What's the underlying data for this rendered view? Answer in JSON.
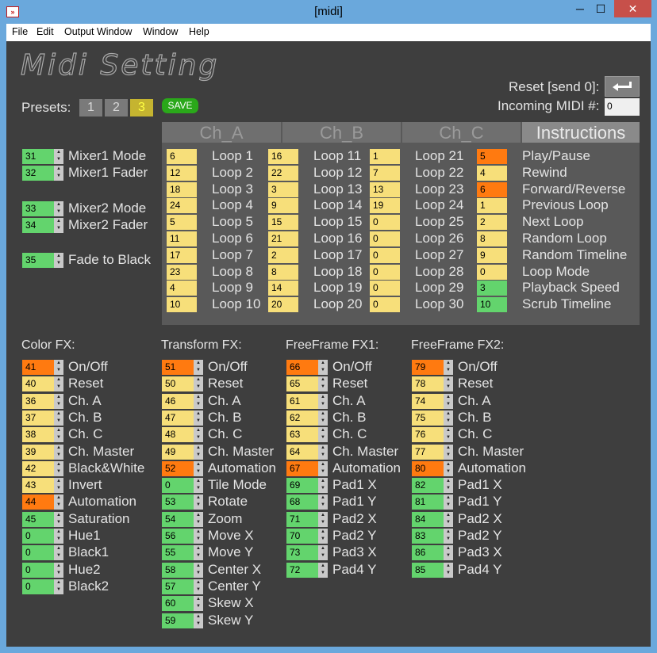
{
  "window": {
    "title": "[midi]",
    "icon": "app-icon",
    "controls": {
      "minimize": "─",
      "maximize": "☐",
      "close": "✕"
    }
  },
  "menu": [
    "File",
    "Edit",
    "Output Window",
    "Window",
    "Help"
  ],
  "heading": "Midi Setting",
  "reset_label": "Reset [send 0]:",
  "incoming_label": "Incoming MIDI #:",
  "incoming_value": "0",
  "presets": {
    "label": "Presets:",
    "items": [
      "1",
      "2",
      "3"
    ],
    "active": "3"
  },
  "save_label": "SAVE",
  "colors": {
    "yellow": "#f7df7a",
    "green": "#63d46d",
    "orange": "#ff7a10"
  },
  "mixers": [
    {
      "value": "31",
      "label": "Mixer1 Mode",
      "color": "green"
    },
    {
      "value": "32",
      "label": "Mixer1 Fader",
      "color": "green"
    },
    {
      "value": "33",
      "label": "Mixer2 Mode",
      "color": "green"
    },
    {
      "value": "34",
      "label": "Mixer2 Fader",
      "color": "green"
    },
    {
      "value": "35",
      "label": "Fade to Black",
      "color": "green"
    }
  ],
  "tabs": [
    "Ch_A",
    "Ch_B",
    "Ch_C",
    "Instructions"
  ],
  "ch_a": [
    {
      "value": "6",
      "label": "Loop 1"
    },
    {
      "value": "12",
      "label": "Loop 2"
    },
    {
      "value": "18",
      "label": "Loop 3"
    },
    {
      "value": "24",
      "label": "Loop 4"
    },
    {
      "value": "5",
      "label": "Loop 5"
    },
    {
      "value": "11",
      "label": "Loop 6"
    },
    {
      "value": "17",
      "label": "Loop 7"
    },
    {
      "value": "23",
      "label": "Loop 8"
    },
    {
      "value": "4",
      "label": "Loop 9"
    },
    {
      "value": "10",
      "label": "Loop 10"
    }
  ],
  "ch_b": [
    {
      "value": "16",
      "label": "Loop 11"
    },
    {
      "value": "22",
      "label": "Loop 12"
    },
    {
      "value": "3",
      "label": "Loop 13"
    },
    {
      "value": "9",
      "label": "Loop 14"
    },
    {
      "value": "15",
      "label": "Loop 15"
    },
    {
      "value": "21",
      "label": "Loop 16"
    },
    {
      "value": "2",
      "label": "Loop 17"
    },
    {
      "value": "8",
      "label": "Loop 18"
    },
    {
      "value": "14",
      "label": "Loop 19"
    },
    {
      "value": "20",
      "label": "Loop 20"
    }
  ],
  "ch_c": [
    {
      "value": "1",
      "label": "Loop 21"
    },
    {
      "value": "7",
      "label": "Loop 22"
    },
    {
      "value": "13",
      "label": "Loop 23"
    },
    {
      "value": "19",
      "label": "Loop 24"
    },
    {
      "value": "0",
      "label": "Loop 25"
    },
    {
      "value": "0",
      "label": "Loop 26"
    },
    {
      "value": "0",
      "label": "Loop 27"
    },
    {
      "value": "0",
      "label": "Loop 28"
    },
    {
      "value": "0",
      "label": "Loop 29"
    },
    {
      "value": "0",
      "label": "Loop 30"
    }
  ],
  "instructions": [
    {
      "value": "5",
      "label": "Play/Pause",
      "color": "orange"
    },
    {
      "value": "4",
      "label": "Rewind",
      "color": "yellow"
    },
    {
      "value": "6",
      "label": "Forward/Reverse",
      "color": "orange"
    },
    {
      "value": "1",
      "label": "Previous Loop",
      "color": "yellow"
    },
    {
      "value": "2",
      "label": "Next Loop",
      "color": "yellow"
    },
    {
      "value": "8",
      "label": "Random Loop",
      "color": "yellow"
    },
    {
      "value": "9",
      "label": "Random Timeline",
      "color": "yellow"
    },
    {
      "value": "0",
      "label": "Loop Mode",
      "color": "yellow"
    },
    {
      "value": "3",
      "label": "Playback Speed",
      "color": "green"
    },
    {
      "value": "10",
      "label": "Scrub Timeline",
      "color": "green"
    }
  ],
  "fx_sections": [
    {
      "title": "Color FX:",
      "items": [
        {
          "value": "41",
          "label": "On/Off",
          "color": "orange"
        },
        {
          "value": "40",
          "label": "Reset",
          "color": "yellow"
        },
        {
          "value": "36",
          "label": "Ch. A",
          "color": "yellow"
        },
        {
          "value": "37",
          "label": "Ch. B",
          "color": "yellow"
        },
        {
          "value": "38",
          "label": "Ch. C",
          "color": "yellow"
        },
        {
          "value": "39",
          "label": "Ch. Master",
          "color": "yellow"
        },
        {
          "value": "42",
          "label": "Black&White",
          "color": "yellow"
        },
        {
          "value": "43",
          "label": "Invert",
          "color": "yellow"
        },
        {
          "value": "44",
          "label": "Automation",
          "color": "orange"
        },
        {
          "value": "45",
          "label": "Saturation",
          "color": "green"
        },
        {
          "value": "0",
          "label": "Hue1",
          "color": "green"
        },
        {
          "value": "0",
          "label": "Black1",
          "color": "green"
        },
        {
          "value": "0",
          "label": "Hue2",
          "color": "green"
        },
        {
          "value": "0",
          "label": "Black2",
          "color": "green"
        }
      ]
    },
    {
      "title": "Transform FX:",
      "items": [
        {
          "value": "51",
          "label": "On/Off",
          "color": "orange"
        },
        {
          "value": "50",
          "label": "Reset",
          "color": "yellow"
        },
        {
          "value": "46",
          "label": "Ch. A",
          "color": "yellow"
        },
        {
          "value": "47",
          "label": "Ch. B",
          "color": "yellow"
        },
        {
          "value": "48",
          "label": "Ch. C",
          "color": "yellow"
        },
        {
          "value": "49",
          "label": "Ch. Master",
          "color": "yellow"
        },
        {
          "value": "52",
          "label": "Automation",
          "color": "orange"
        },
        {
          "value": "0",
          "label": "Tile Mode",
          "color": "green"
        },
        {
          "value": "53",
          "label": "Rotate",
          "color": "green"
        },
        {
          "value": "54",
          "label": "Zoom",
          "color": "green"
        },
        {
          "value": "56",
          "label": "Move X",
          "color": "green"
        },
        {
          "value": "55",
          "label": "Move Y",
          "color": "green"
        },
        {
          "value": "58",
          "label": "Center X",
          "color": "green"
        },
        {
          "value": "57",
          "label": "Center Y",
          "color": "green"
        },
        {
          "value": "60",
          "label": "Skew X",
          "color": "green"
        },
        {
          "value": "59",
          "label": "Skew Y",
          "color": "green"
        }
      ]
    },
    {
      "title": "FreeFrame FX1:",
      "items": [
        {
          "value": "66",
          "label": "On/Off",
          "color": "orange"
        },
        {
          "value": "65",
          "label": "Reset",
          "color": "yellow"
        },
        {
          "value": "61",
          "label": "Ch. A",
          "color": "yellow"
        },
        {
          "value": "62",
          "label": "Ch. B",
          "color": "yellow"
        },
        {
          "value": "63",
          "label": "Ch. C",
          "color": "yellow"
        },
        {
          "value": "64",
          "label": "Ch. Master",
          "color": "yellow"
        },
        {
          "value": "67",
          "label": "Automation",
          "color": "orange"
        },
        {
          "value": "69",
          "label": "Pad1 X",
          "color": "green"
        },
        {
          "value": "68",
          "label": "Pad1 Y",
          "color": "green"
        },
        {
          "value": "71",
          "label": "Pad2 X",
          "color": "green"
        },
        {
          "value": "70",
          "label": "Pad2 Y",
          "color": "green"
        },
        {
          "value": "73",
          "label": "Pad3 X",
          "color": "green"
        },
        {
          "value": "72",
          "label": "Pad4 Y",
          "color": "green"
        }
      ]
    },
    {
      "title": "FreeFrame FX2:",
      "items": [
        {
          "value": "79",
          "label": "On/Off",
          "color": "orange"
        },
        {
          "value": "78",
          "label": "Reset",
          "color": "yellow"
        },
        {
          "value": "74",
          "label": "Ch. A",
          "color": "yellow"
        },
        {
          "value": "75",
          "label": "Ch. B",
          "color": "yellow"
        },
        {
          "value": "76",
          "label": "Ch. C",
          "color": "yellow"
        },
        {
          "value": "77",
          "label": "Ch. Master",
          "color": "yellow"
        },
        {
          "value": "80",
          "label": "Automation",
          "color": "orange"
        },
        {
          "value": "82",
          "label": "Pad1 X",
          "color": "green"
        },
        {
          "value": "81",
          "label": "Pad1 Y",
          "color": "green"
        },
        {
          "value": "84",
          "label": "Pad2 X",
          "color": "green"
        },
        {
          "value": "83",
          "label": "Pad2 Y",
          "color": "green"
        },
        {
          "value": "86",
          "label": "Pad3 X",
          "color": "green"
        },
        {
          "value": "85",
          "label": "Pad4 Y",
          "color": "green"
        }
      ]
    }
  ]
}
